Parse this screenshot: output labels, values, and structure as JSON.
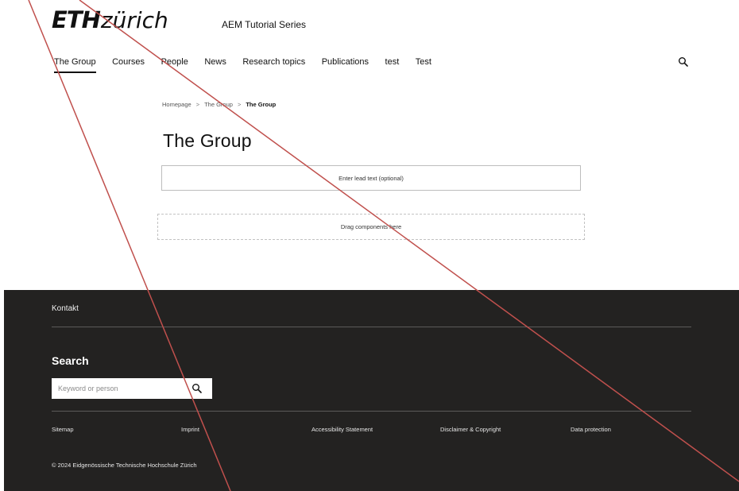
{
  "header": {
    "logo_eth": "ETH",
    "logo_zurich": "zürich",
    "site_title": "AEM Tutorial Series"
  },
  "nav": {
    "items": [
      {
        "label": "The Group",
        "active": true
      },
      {
        "label": "Courses"
      },
      {
        "label": "People"
      },
      {
        "label": "News"
      },
      {
        "label": "Research topics"
      },
      {
        "label": "Publications"
      },
      {
        "label": "test"
      },
      {
        "label": "Test"
      }
    ],
    "search_icon": "search-icon"
  },
  "breadcrumb": {
    "items": [
      "Homepage",
      "The Group",
      "The Group"
    ],
    "separator": ">"
  },
  "main": {
    "title": "The Group",
    "lead_placeholder": "Enter lead text (optional)",
    "drop_zone": "Drag components here"
  },
  "footer": {
    "contact": "Kontakt",
    "search_title": "Search",
    "search_placeholder": "Keyword or person",
    "search_icon": "search-icon",
    "links": [
      "Sitemap",
      "Imprint",
      "Accessibility Statement",
      "Disclaimer & Copyright",
      "Data protection"
    ],
    "copyright": "© 2024  Eidgenössische Technische Hochschule Zürich",
    "background": "#232221"
  },
  "overlay": {
    "color": "#c0504d"
  }
}
